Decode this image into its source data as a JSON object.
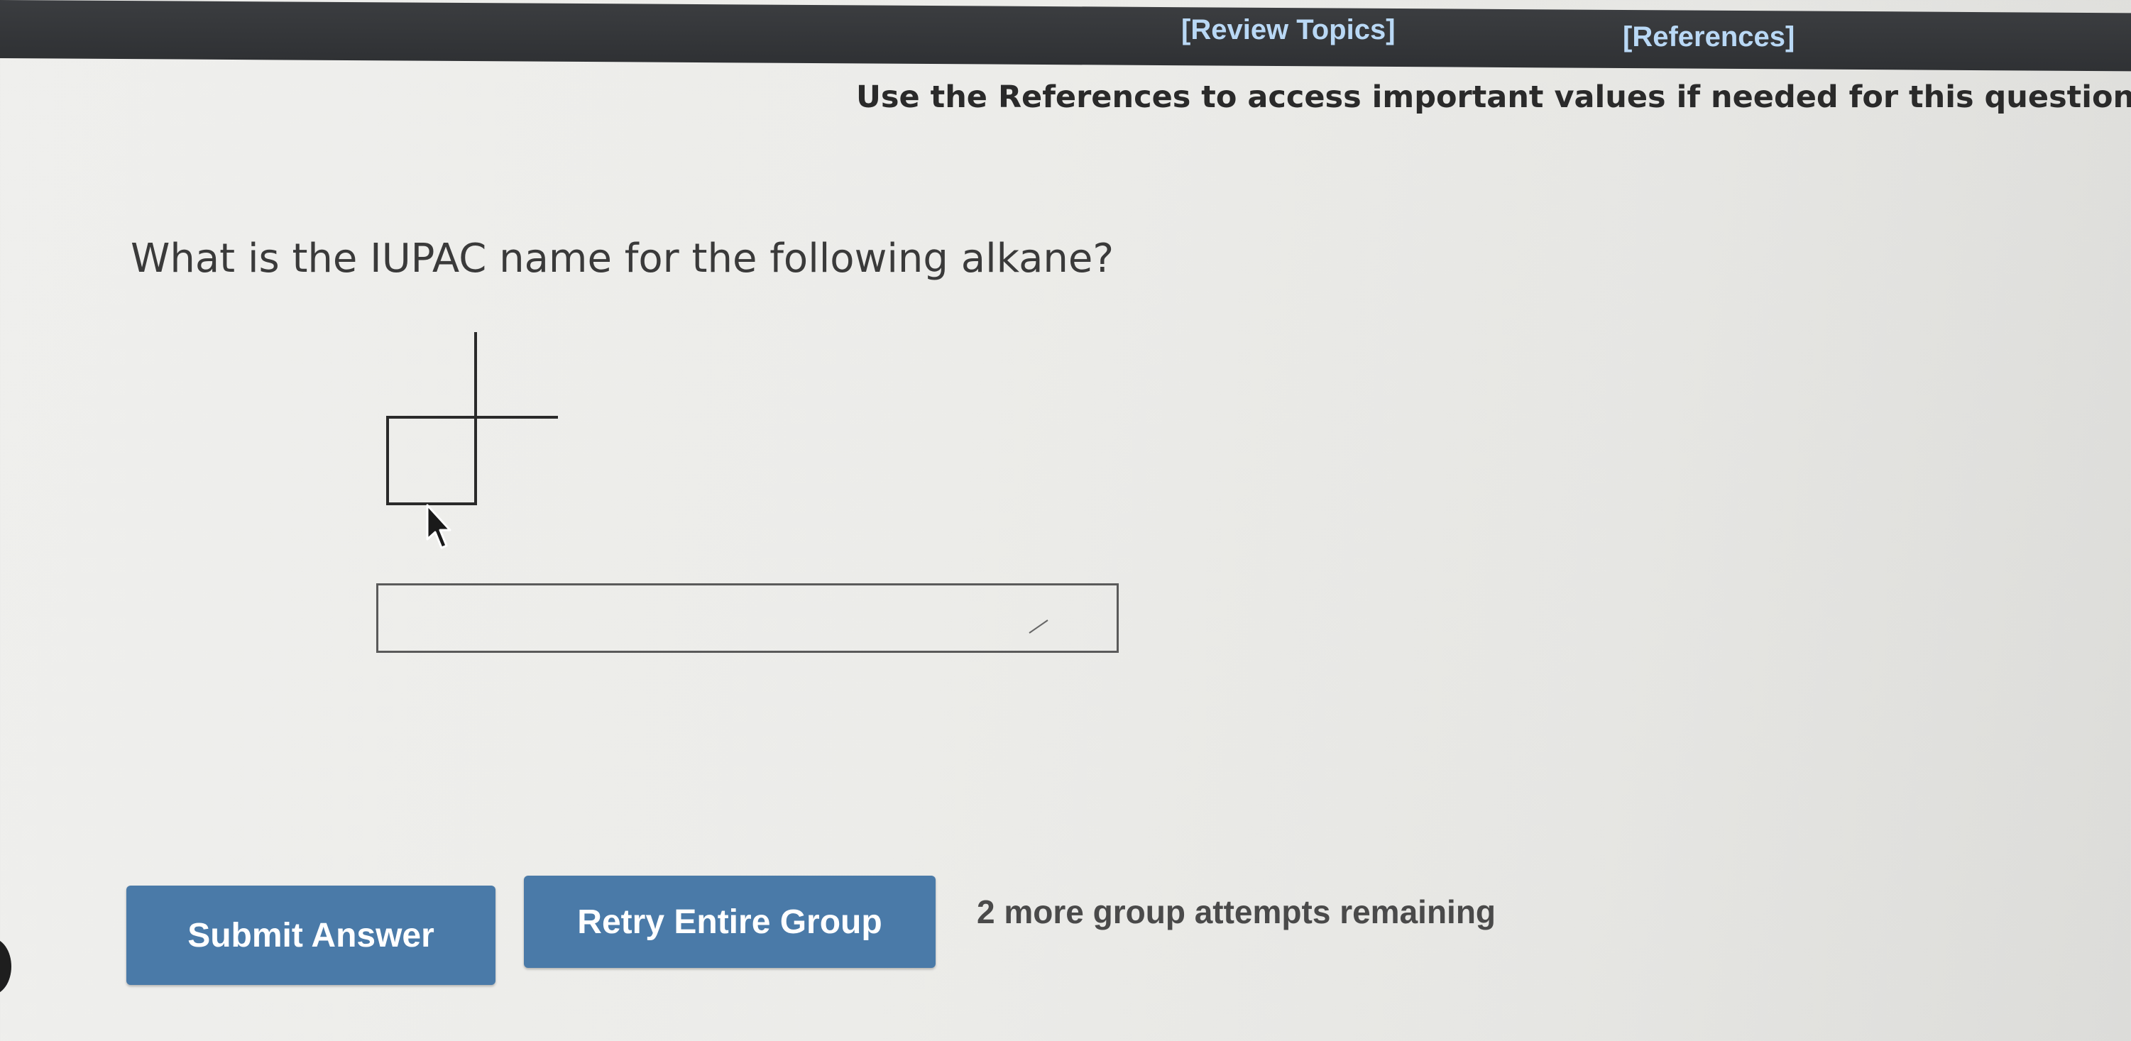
{
  "header": {
    "review_topics": "[Review Topics]",
    "references": "[References]"
  },
  "instruction": "Use the References to access important values if needed for this question.",
  "question": "What is the IUPAC name for the following alkane?",
  "structure": {
    "icon": "skeletal-structure-cyclobutane-with-branched-substituent"
  },
  "answer": {
    "value": "",
    "placeholder": ""
  },
  "actions": {
    "submit_label": "Submit Answer",
    "retry_label": "Retry Entire Group",
    "attempts_text": "2 more group attempts remaining"
  },
  "colors": {
    "button_blue": "#4a7aa8",
    "topbar_dark": "#2f3134",
    "link_blue": "#b9d8f5"
  }
}
